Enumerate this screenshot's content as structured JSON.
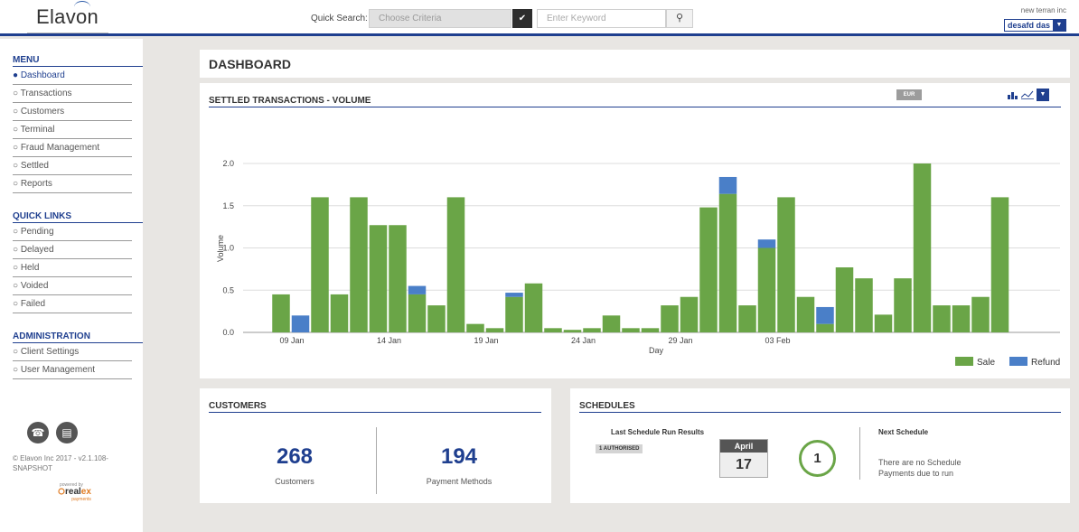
{
  "header": {
    "logo": "Elavon",
    "quick_search_label": "Quick Search:",
    "criteria_placeholder": "Choose Criteria",
    "keyword_placeholder": "Enter Keyword",
    "company": "new terran inc",
    "user": "desafd das"
  },
  "sidebar": {
    "menu_heading": "MENU",
    "menu_items": [
      {
        "label": "Dashboard",
        "active": true
      },
      {
        "label": "Transactions",
        "active": false
      },
      {
        "label": "Customers",
        "active": false
      },
      {
        "label": "Terminal",
        "active": false
      },
      {
        "label": "Fraud Management",
        "active": false
      },
      {
        "label": "Settled",
        "active": false
      },
      {
        "label": "Reports",
        "active": false
      }
    ],
    "quick_links_heading": "QUICK LINKS",
    "quick_links": [
      "Pending",
      "Delayed",
      "Held",
      "Voided",
      "Failed"
    ],
    "admin_heading": "ADMINISTRATION",
    "admin_items": [
      "Client Settings",
      "User Management"
    ],
    "copyright": "© Elavon Inc 2017 - v2.1.108-SNAPSHOT",
    "powered_by": "powered by",
    "partner_logo": "realex payments"
  },
  "dashboard": {
    "title": "DASHBOARD"
  },
  "chart_panel": {
    "title": "SETTLED TRANSACTIONS - VOLUME",
    "currency": "EUR"
  },
  "chart_data": {
    "type": "bar",
    "stacked": true,
    "xlabel": "Day",
    "ylabel": "Volume",
    "ylim": [
      0,
      2.0
    ],
    "yticks": [
      "0.0",
      "0.5",
      "1.0",
      "1.5",
      "2.0"
    ],
    "xticks": [
      {
        "index": 0,
        "label": "09 Jan"
      },
      {
        "index": 5,
        "label": "14 Jan"
      },
      {
        "index": 10,
        "label": "19 Jan"
      },
      {
        "index": 15,
        "label": "24 Jan"
      },
      {
        "index": 20,
        "label": "29 Jan"
      },
      {
        "index": 25,
        "label": "03 Feb"
      }
    ],
    "legend_position": "bottom-right",
    "grid": true,
    "series": [
      {
        "name": "Sale",
        "color": "#6aa547",
        "values": [
          0.45,
          0,
          1.6,
          0.45,
          1.6,
          1.27,
          1.27,
          0.45,
          0.32,
          1.6,
          0.1,
          0.05,
          0.42,
          0.58,
          0.05,
          0.03,
          0.05,
          0.2,
          0.05,
          0.05,
          0.32,
          0.42,
          1.48,
          1.64,
          0.32,
          1.0,
          1.6,
          0.42,
          0.1,
          0.77,
          0.64,
          0.21,
          0.64,
          2.0,
          0.32,
          0.32,
          0.42,
          1.6
        ]
      },
      {
        "name": "Refund",
        "color": "#4a7fc8",
        "values": [
          0,
          0.2,
          0,
          0,
          0,
          0,
          0,
          0.1,
          0,
          0,
          0,
          0,
          0.05,
          0,
          0,
          0,
          0,
          0,
          0,
          0,
          0,
          0,
          0,
          0.2,
          0,
          0.1,
          0,
          0,
          0.2,
          0,
          0,
          0,
          0,
          0,
          0,
          0,
          0,
          0
        ]
      }
    ]
  },
  "customers": {
    "title": "CUSTOMERS",
    "count": "268",
    "count_label": "Customers",
    "payment_methods": "194",
    "payment_methods_label": "Payment Methods"
  },
  "schedules": {
    "title": "SCHEDULES",
    "last_run_label": "Last Schedule Run Results",
    "authorised_badge": "1 AUTHORISED",
    "month": "April",
    "day": "17",
    "ring_count": "1",
    "next_label": "Next Schedule",
    "next_text": "There are no Schedule Payments due to run"
  }
}
